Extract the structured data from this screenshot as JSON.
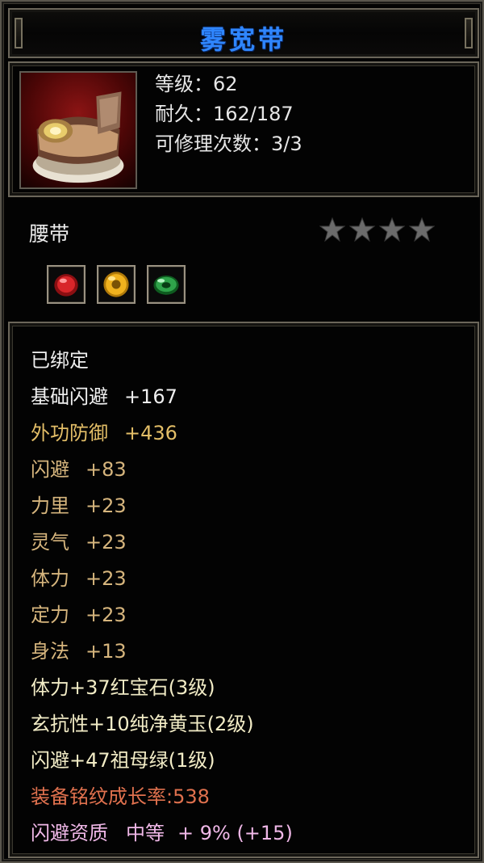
{
  "title": "雾宽带",
  "info": {
    "level": "等级：62",
    "durability": "耐久：162/187",
    "repair": "可修理次数：3/3"
  },
  "item_type": "腰带",
  "stars": {
    "filled": 0,
    "total": 4
  },
  "gems": [
    "ruby-gem-icon",
    "yellow-jade-gem-icon",
    "emerald-gem-icon"
  ],
  "attributes": {
    "bound": "已绑定",
    "base_dodge_name": "基础闪避",
    "base_dodge_value": "+167",
    "ext_def_name": "外功防御",
    "ext_def_value": "+436",
    "dodge_name": "闪避",
    "dodge_value": "+83",
    "str_name": "力里",
    "str_value": "+23",
    "spirit_name": "灵气",
    "spirit_value": "+23",
    "vit_name": "体力",
    "vit_value": "+23",
    "focus_name": "定力",
    "focus_value": "+23",
    "agi_name": "身法",
    "agi_value": "+13",
    "gem1": "体力+37红宝石(3级)",
    "gem2": "玄抗性+10纯净黄玉(2级)",
    "gem3": "闪避+47祖母绿(1级)",
    "growth": "装备铭纹成长率:538",
    "aptitude": "闪避资质",
    "aptitude_grade": "中等",
    "aptitude_bonus": "+ 9% (+15)"
  },
  "colors": {
    "title": "#2f86ff",
    "white": "#efefef",
    "gold": "#e3be67",
    "cream": "#f2ecc6",
    "orange": "#e0714e",
    "pink": "#f0b8e8",
    "star_gray": "#6b6b6b"
  }
}
